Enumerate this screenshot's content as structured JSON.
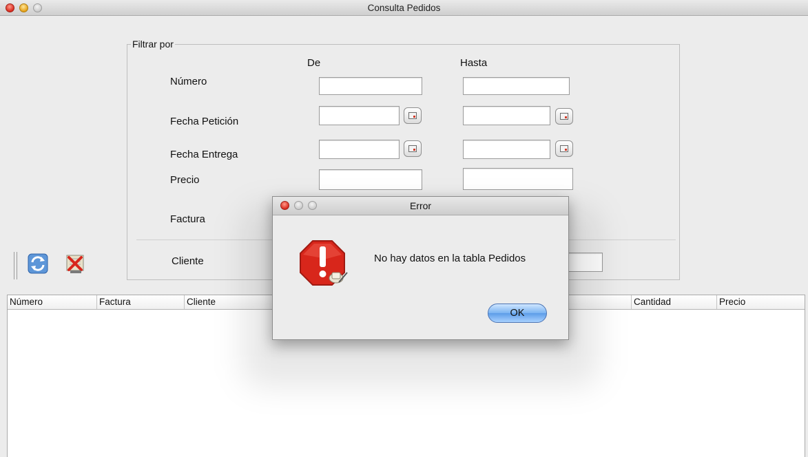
{
  "window": {
    "title": "Consulta Pedidos"
  },
  "filter": {
    "legend": "Filtrar por",
    "col_from": "De",
    "col_to": "Hasta",
    "labels": {
      "numero": "Número",
      "fecha_peticion": "Fecha Petición",
      "fecha_entrega": "Fecha Entrega",
      "precio": "Precio",
      "factura": "Factura",
      "cliente": "Cliente"
    },
    "values": {
      "numero_de": "",
      "numero_hasta": "",
      "fecha_peticion_de": "",
      "fecha_peticion_hasta": "",
      "fecha_entrega_de": "",
      "fecha_entrega_hasta": "",
      "precio_de": "",
      "precio_hasta": "",
      "cliente": ""
    }
  },
  "toolbar": {
    "icons": [
      "refresh-icon",
      "clear-filter-icon"
    ]
  },
  "table": {
    "columns": [
      "Número",
      "Factura",
      "Cliente",
      "",
      "Cantidad",
      "Precio"
    ],
    "rows": []
  },
  "dialog": {
    "title": "Error",
    "message": "No hay datos en la tabla Pedidos",
    "ok_label": "OK",
    "icon": "error-stop-icon"
  },
  "colors": {
    "window_bg": "#ececec",
    "ok_button": "#7ab3f2",
    "error_red": "#d8261b"
  }
}
